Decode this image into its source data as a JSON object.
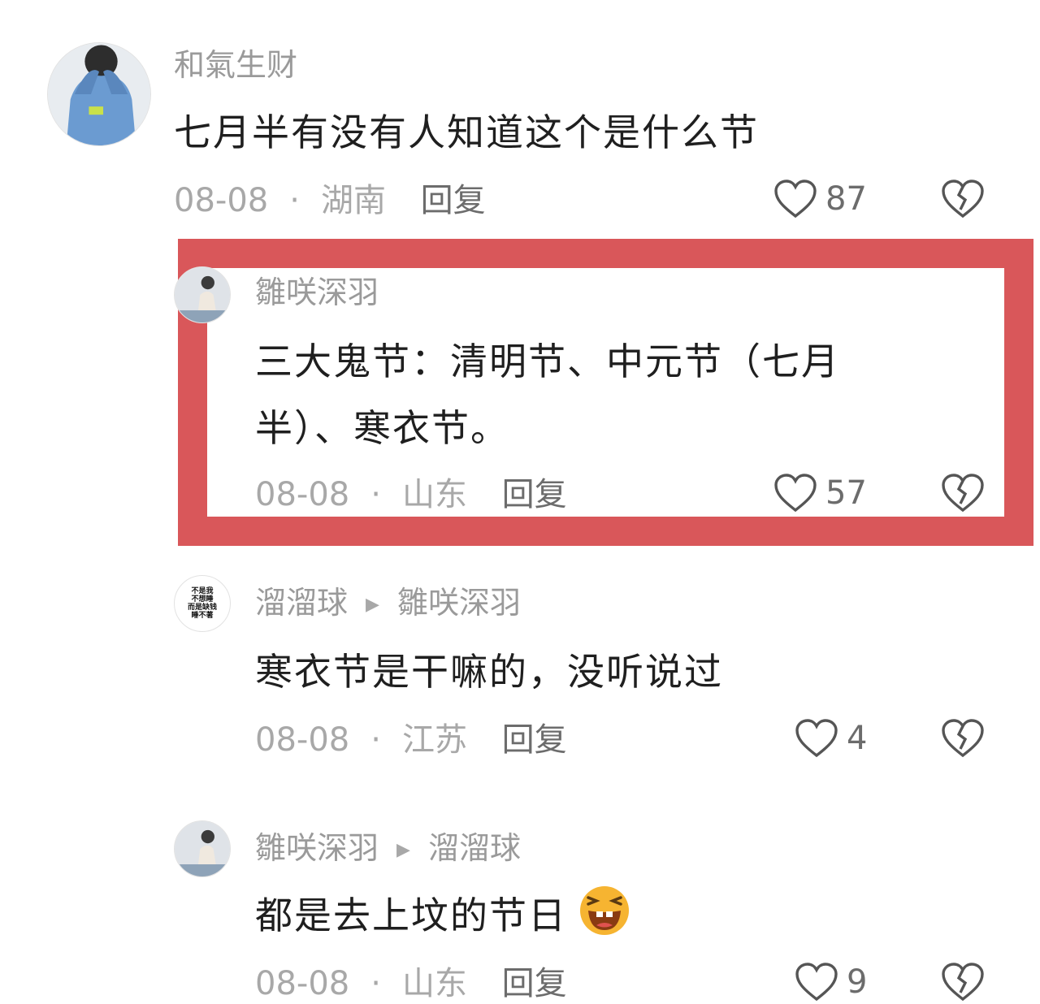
{
  "comments": [
    {
      "username": "和氣生财",
      "text": "七月半有没有人知道这个是什么节",
      "date": "08-08",
      "location": "湖南",
      "reply_label": "回复",
      "likes": "87"
    },
    {
      "username": "雛咲深羽",
      "text_line1": "三大鬼节：清明节、中元节（七月",
      "text_line2": "半）、寒衣节。",
      "date": "08-08",
      "location": "山东",
      "reply_label": "回复",
      "likes": "57"
    },
    {
      "username": "溜溜球",
      "reply_to": "雛咲深羽",
      "avatar_text": [
        "不是我",
        "不想睡",
        "而是缺钱",
        "睡不著"
      ],
      "text": "寒衣节是干嘛的，没听说过",
      "date": "08-08",
      "location": "江苏",
      "reply_label": "回复",
      "likes": "4"
    },
    {
      "username": "雛咲深羽",
      "reply_to": "溜溜球",
      "text": "都是去上坟的节日",
      "emoji": "laughing-emoji",
      "date": "08-08",
      "location": "山东",
      "reply_label": "回复",
      "likes": "9"
    }
  ],
  "separator": "·",
  "colors": {
    "highlight_border": "#d9575a",
    "meta_text": "#a8a8a8",
    "name_text": "#9a9a9a"
  }
}
